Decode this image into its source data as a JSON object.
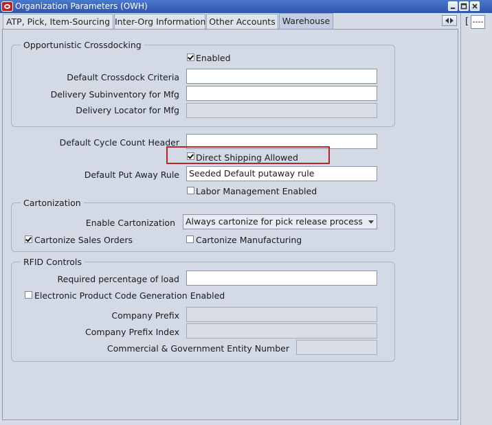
{
  "window": {
    "title": "Organization Parameters (OWH)",
    "buttons": [
      "minimize",
      "maximize",
      "close"
    ]
  },
  "tabs": [
    {
      "label": "ATP, Pick, Item-Sourcing",
      "active": false
    },
    {
      "label": "Inter-Org Information",
      "active": false
    },
    {
      "label": "Other Accounts",
      "active": false
    },
    {
      "label": "Warehouse",
      "active": true
    }
  ],
  "side_panel": {
    "bracket": "[",
    "field_value": "----"
  },
  "crossdocking": {
    "title": "Opportunistic Crossdocking",
    "enabled": {
      "label": "Enabled",
      "checked": true
    },
    "default_criteria": {
      "label": "Default Crossdock Criteria",
      "value": ""
    },
    "delivery_subinventory": {
      "label": "Delivery Subinventory for Mfg",
      "value": ""
    },
    "delivery_locator": {
      "label": "Delivery Locator for Mfg",
      "value": ""
    }
  },
  "general": {
    "cycle_count_header": {
      "label": "Default Cycle Count Header",
      "value": ""
    },
    "direct_shipping": {
      "label": "Direct Shipping Allowed",
      "checked": true
    },
    "put_away_rule": {
      "label": "Default Put Away Rule",
      "value": "Seeded Default putaway rule"
    },
    "labor_management": {
      "label": "Labor Management Enabled",
      "checked": false
    }
  },
  "cartonization": {
    "title": "Cartonization",
    "enable": {
      "label": "Enable Cartonization",
      "value": "Always cartonize for pick release process"
    },
    "sales_orders": {
      "label": "Cartonize Sales Orders",
      "checked": true
    },
    "manufacturing": {
      "label": "Cartonize Manufacturing",
      "checked": false
    }
  },
  "rfid": {
    "title": "RFID Controls",
    "required_percentage": {
      "label": "Required percentage of load",
      "value": ""
    },
    "epc_generation": {
      "label": "Electronic Product Code Generation Enabled",
      "checked": false
    },
    "company_prefix": {
      "label": "Company Prefix",
      "value": ""
    },
    "company_prefix_index": {
      "label": "Company Prefix Index",
      "value": ""
    },
    "cage_number": {
      "label": "Commercial & Government Entity Number",
      "value": ""
    }
  },
  "colors": {
    "title_bar": "#3a63b8",
    "highlight_border": "#b3262b",
    "panel_bg": "#d3d9e5"
  }
}
